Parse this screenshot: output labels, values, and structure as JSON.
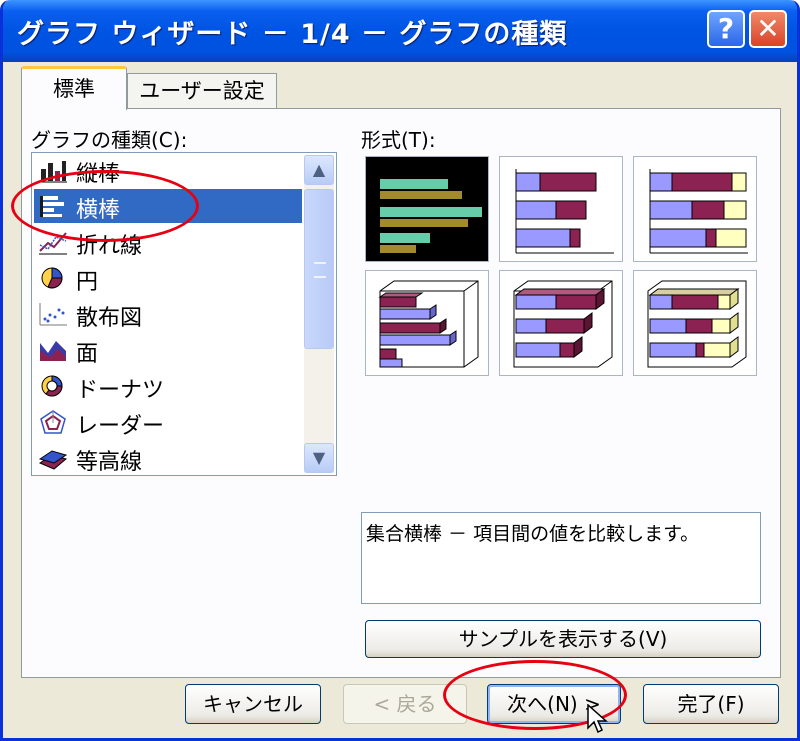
{
  "window": {
    "title": "グラフ ウィザード － 1/4 － グラフの種類",
    "help_label": "?",
    "close_label": "✕"
  },
  "tabs": [
    {
      "label": "標準",
      "active": true
    },
    {
      "label": "ユーザー設定",
      "active": false
    }
  ],
  "chart_type": {
    "label": "グラフの種類(C):",
    "items": [
      {
        "label": "縦棒",
        "icon": "column-chart-icon"
      },
      {
        "label": "横棒",
        "icon": "bar-chart-icon",
        "selected": true
      },
      {
        "label": "折れ線",
        "icon": "line-chart-icon"
      },
      {
        "label": "円",
        "icon": "pie-chart-icon"
      },
      {
        "label": "散布図",
        "icon": "scatter-chart-icon"
      },
      {
        "label": "面",
        "icon": "area-chart-icon"
      },
      {
        "label": "ドーナツ",
        "icon": "doughnut-chart-icon"
      },
      {
        "label": "レーダー",
        "icon": "radar-chart-icon"
      },
      {
        "label": "等高線",
        "icon": "surface-chart-icon"
      }
    ],
    "scroll_up": "▲",
    "scroll_down": "▼"
  },
  "subtype": {
    "label": "形式(T):",
    "selected_index": 0
  },
  "description": "集合横棒 － 項目間の値を比較します。",
  "buttons": {
    "sample": "サンプルを表示する(V)",
    "cancel": "キャンセル",
    "back": "< 戻る",
    "next": "次へ(N) >",
    "finish": "完了(F)"
  },
  "colors": {
    "titlebar": "#0054e3",
    "selection": "#316ac5",
    "annotation": "#e60012",
    "series_purple": "#8b2252",
    "series_blue": "#9999ff",
    "series_yellow": "#ffffc0"
  }
}
